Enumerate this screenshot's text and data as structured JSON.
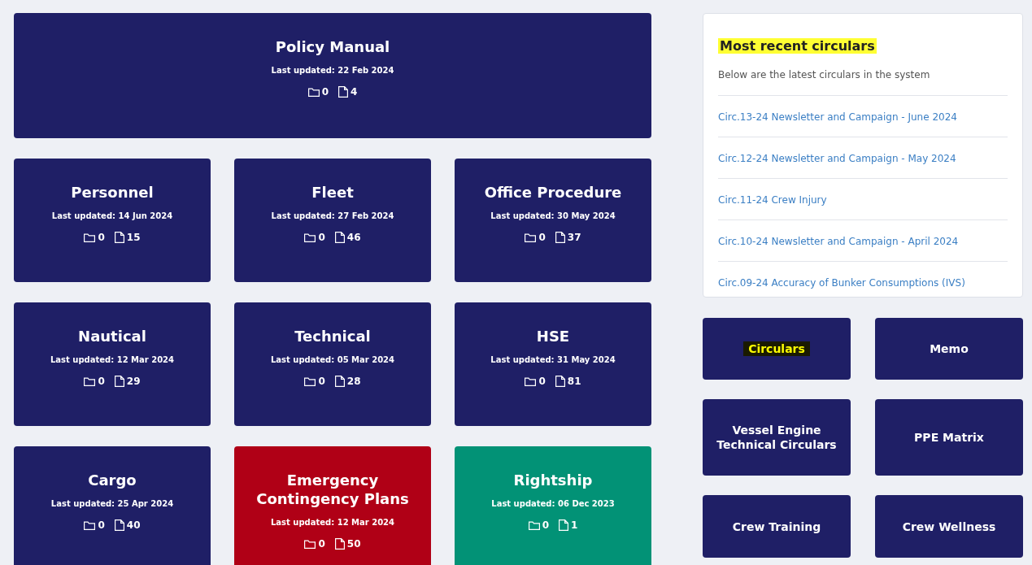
{
  "featured": {
    "title": "Policy Manual",
    "updated": "Last updated: 22 Feb 2024",
    "folders": "0",
    "files": "4",
    "color": "#1f1f66"
  },
  "categories": [
    {
      "title": "Personnel",
      "updated": "Last updated: 14 Jun 2024",
      "folders": "0",
      "files": "15",
      "color": "#1f1f66"
    },
    {
      "title": "Fleet",
      "updated": "Last updated: 27 Feb 2024",
      "folders": "0",
      "files": "46",
      "color": "#1f1f66"
    },
    {
      "title": "Office Procedure",
      "updated": "Last updated: 30 May 2024",
      "folders": "0",
      "files": "37",
      "color": "#1f1f66"
    },
    {
      "title": "Nautical",
      "updated": "Last updated: 12 Mar 2024",
      "folders": "0",
      "files": "29",
      "color": "#1f1f66"
    },
    {
      "title": "Technical",
      "updated": "Last updated: 05 Mar 2024",
      "folders": "0",
      "files": "28",
      "color": "#1f1f66"
    },
    {
      "title": "HSE",
      "updated": "Last updated: 31 May 2024",
      "folders": "0",
      "files": "81",
      "color": "#1f1f66"
    },
    {
      "title": "Cargo",
      "updated": "Last updated: 25 Apr 2024",
      "folders": "0",
      "files": "40",
      "color": "#1f1f66"
    },
    {
      "title": "Emergency Contingency Plans",
      "updated": "Last updated: 12 Mar 2024",
      "folders": "0",
      "files": "50",
      "color": "#b00016"
    },
    {
      "title": "Rightship",
      "updated": "Last updated: 06 Dec 2023",
      "folders": "0",
      "files": "1",
      "color": "#029276"
    }
  ],
  "recent": {
    "title": "Most recent circulars",
    "highlighted": true,
    "subtitle": "Below are the latest circulars in the system",
    "links": [
      "Circ.13-24 Newsletter and Campaign - June 2024",
      "Circ.12-24 Newsletter and Campaign - May 2024",
      "Circ.11-24 Crew Injury",
      "Circ.10-24 Newsletter and Campaign - April 2024",
      "Circ.09-24 Accuracy of Bunker Consumptions (IVS)"
    ]
  },
  "shortcuts": [
    {
      "label": "Circulars",
      "highlighted": true
    },
    {
      "label": "Memo",
      "highlighted": false
    },
    {
      "label": "Vessel Engine Technical Circulars",
      "highlighted": false
    },
    {
      "label": "PPE Matrix",
      "highlighted": false
    },
    {
      "label": "Crew Training",
      "highlighted": false
    },
    {
      "label": "Crew Wellness",
      "highlighted": false
    }
  ]
}
